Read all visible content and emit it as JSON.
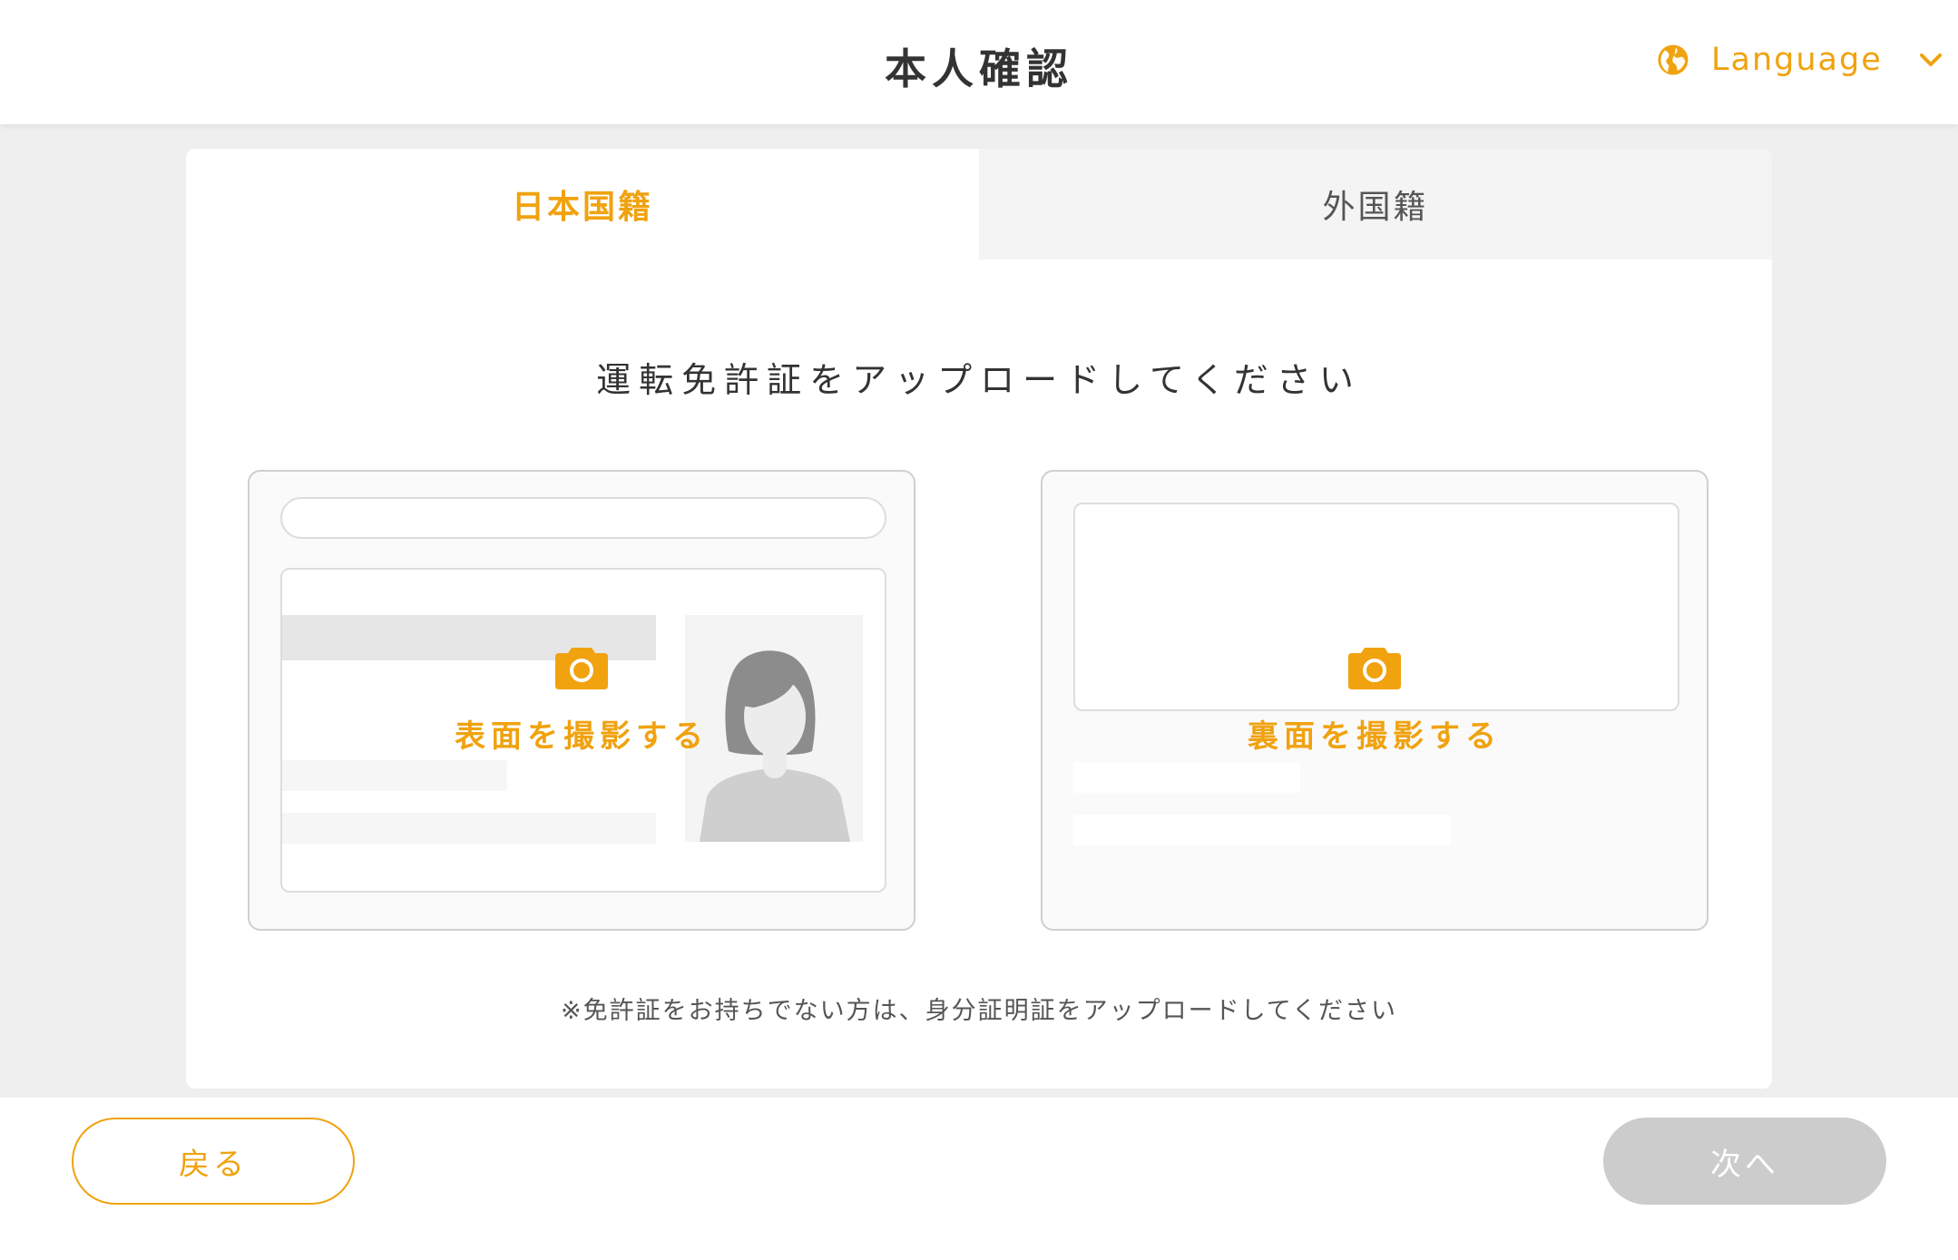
{
  "header": {
    "title": "本人確認",
    "language_label": "Language"
  },
  "tabs": [
    {
      "label": "日本国籍",
      "active": true
    },
    {
      "label": "外国籍",
      "active": false
    }
  ],
  "main": {
    "heading": "運転免許証をアップロードしてください",
    "front_label": "表面を撮影する",
    "back_label": "裏面を撮影する",
    "note": "※免許証をお持ちでない方は、身分証明証をアップロードしてください"
  },
  "footer": {
    "back_label": "戻る",
    "next_label": "次へ"
  },
  "colors": {
    "accent": "#f0a20f",
    "disabled": "#cccccc",
    "background": "#efefef"
  },
  "icons": [
    "globe-icon",
    "chevron-down-icon",
    "camera-icon",
    "person-silhouette"
  ]
}
